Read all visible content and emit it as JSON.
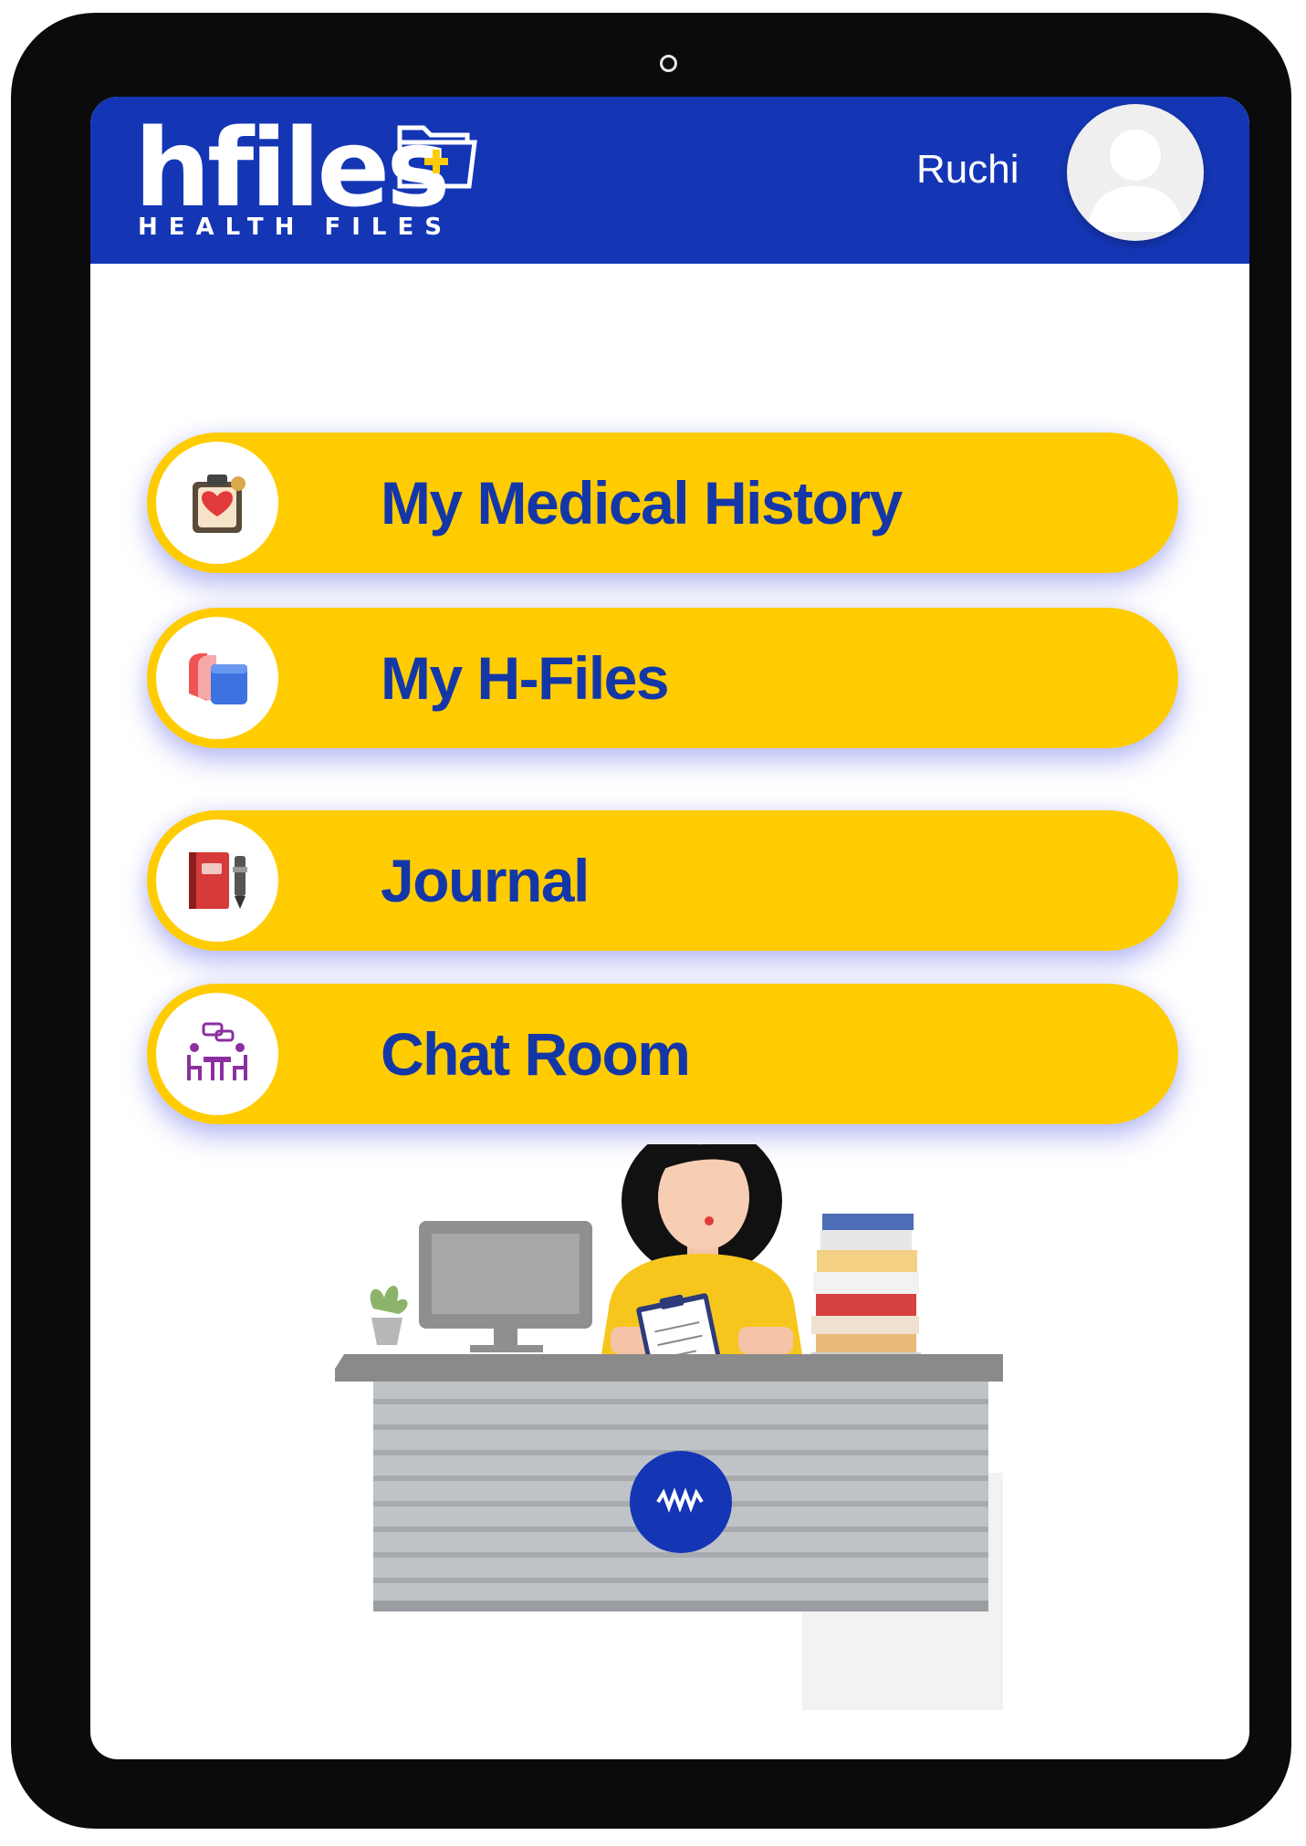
{
  "app": {
    "brand": "hfiles",
    "tagline": "HEALTH FILES"
  },
  "header": {
    "user_name": "Ruchi",
    "avatar_icon": "user-avatar-icon"
  },
  "menu": [
    {
      "label": "My Medical History",
      "icon": "medical-history-icon"
    },
    {
      "label": "My H-Files",
      "icon": "files-folder-icon"
    },
    {
      "label": "Journal",
      "icon": "journal-book-icon"
    },
    {
      "label": "Chat Room",
      "icon": "chat-room-icon"
    }
  ],
  "colors": {
    "header_bg": "#1436b5",
    "button_bg": "#ffcc02",
    "button_text": "#1437a8",
    "device_frame": "#0b0b0b"
  }
}
